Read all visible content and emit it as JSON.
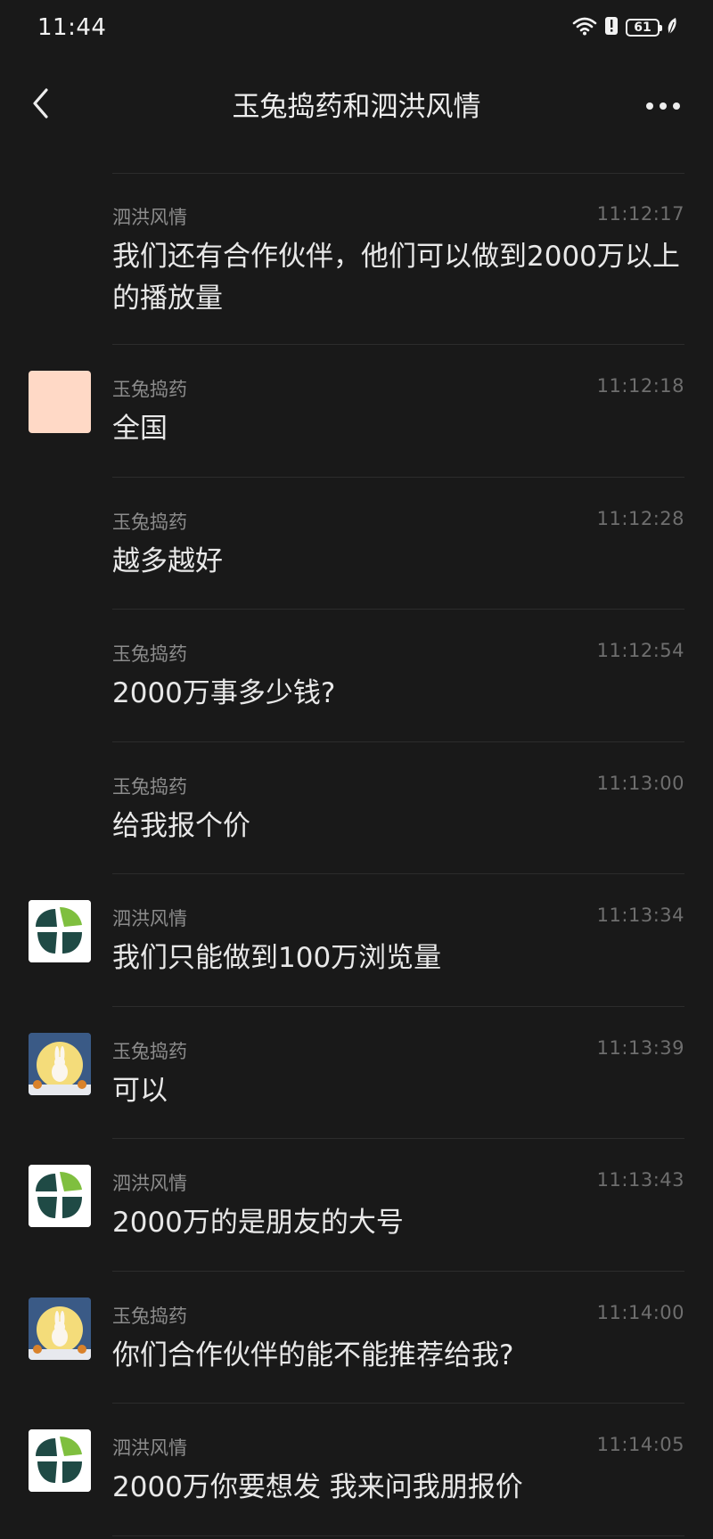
{
  "status_bar": {
    "time": "11:44",
    "battery": "61"
  },
  "header": {
    "title": "玉兔捣药和泗洪风情"
  },
  "messages": [
    {
      "sender": "泗洪风情",
      "time": "11:12:17",
      "text": "我们还有合作伙伴，他们可以做到2000万以上的播放量",
      "avatar": "none"
    },
    {
      "sender": "玉兔捣药",
      "time": "11:12:18",
      "text": "全国",
      "avatar": "peach"
    },
    {
      "sender": "玉兔捣药",
      "time": "11:12:28",
      "text": "越多越好",
      "avatar": "none"
    },
    {
      "sender": "玉兔捣药",
      "time": "11:12:54",
      "text": "2000万事多少钱?",
      "avatar": "none"
    },
    {
      "sender": "玉兔捣药",
      "time": "11:13:00",
      "text": "给我报个价",
      "avatar": "none"
    },
    {
      "sender": "泗洪风情",
      "time": "11:13:34",
      "text": "我们只能做到100万浏览量",
      "avatar": "logo"
    },
    {
      "sender": "玉兔捣药",
      "time": "11:13:39",
      "text": "可以",
      "avatar": "moon"
    },
    {
      "sender": "泗洪风情",
      "time": "11:13:43",
      "text": "2000万的是朋友的大号",
      "avatar": "logo"
    },
    {
      "sender": "玉兔捣药",
      "time": "11:14:00",
      "text": "你们合作伙伴的能不能推荐给我?",
      "avatar": "moon"
    },
    {
      "sender": "泗洪风情",
      "time": "11:14:05",
      "text": "2000万你要想发 我来问我朋报价",
      "avatar": "logo"
    }
  ],
  "colors": {
    "background": "#191919",
    "logo_green": "#7fbf3f",
    "logo_dark": "#1f4a45"
  },
  "icons": {
    "back": "chevron-left-icon",
    "more": "more-dots-icon",
    "wifi": "wifi-icon",
    "alert": "alert-icon",
    "battery": "battery-icon",
    "leaf": "leaf-icon"
  }
}
